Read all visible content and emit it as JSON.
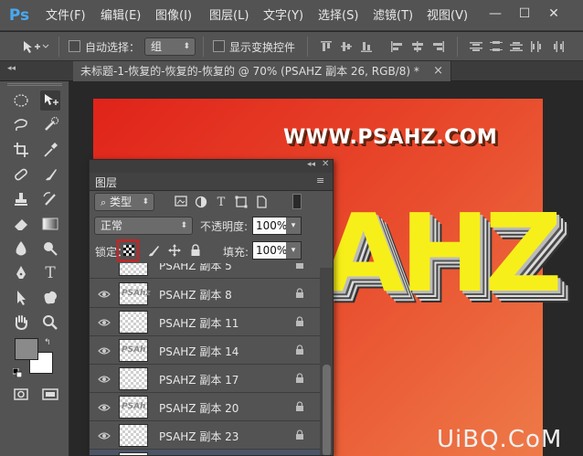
{
  "menubar": {
    "logo": "Ps",
    "items": [
      "文件(F)",
      "编辑(E)",
      "图像(I)",
      "图层(L)",
      "文字(Y)",
      "选择(S)",
      "滤镜(T)",
      "视图(V)"
    ],
    "window_buttons": [
      "—",
      "☐",
      "✕"
    ]
  },
  "optionsbar": {
    "auto_select_label": "自动选择：",
    "auto_select_value": "组",
    "show_transform_label": "显示变换控件"
  },
  "document_tab": {
    "title": "未标题-1-恢复的-恢复的-恢复的 @ 70% (PSAHZ 副本 26, RGB/8) *",
    "close": "×"
  },
  "canvas": {
    "url_text": "WWW.PSAHZ.COM",
    "big_text": "AHZ"
  },
  "layers_panel": {
    "tab_label": "图层",
    "filter_kind": "类型",
    "blend_mode": "正常",
    "opacity_label": "不透明度:",
    "opacity_value": "100%",
    "lock_label": "锁定：",
    "fill_label": "填充:",
    "fill_value": "100%",
    "layers": [
      {
        "name": "PSAHZ 副本 5",
        "thumb_text": ""
      },
      {
        "name": "PSAHZ 副本 8",
        "thumb_text": "PSAhz"
      },
      {
        "name": "PSAHZ 副本 11",
        "thumb_text": ""
      },
      {
        "name": "PSAHZ 副本 14",
        "thumb_text": "PSAh"
      },
      {
        "name": "PSAHZ 副本 17",
        "thumb_text": ""
      },
      {
        "name": "PSAHZ 副本 20",
        "thumb_text": "PSAh"
      },
      {
        "name": "PSAHZ 副本 23",
        "thumb_text": ""
      }
    ]
  },
  "watermark": "UiBQ.CoM",
  "colors": {
    "accent_logo": "#4aa8f0",
    "highlight_red": "#e01a1a",
    "canvas_red": "#e0231a",
    "text_yellow": "#f7ef1a"
  }
}
